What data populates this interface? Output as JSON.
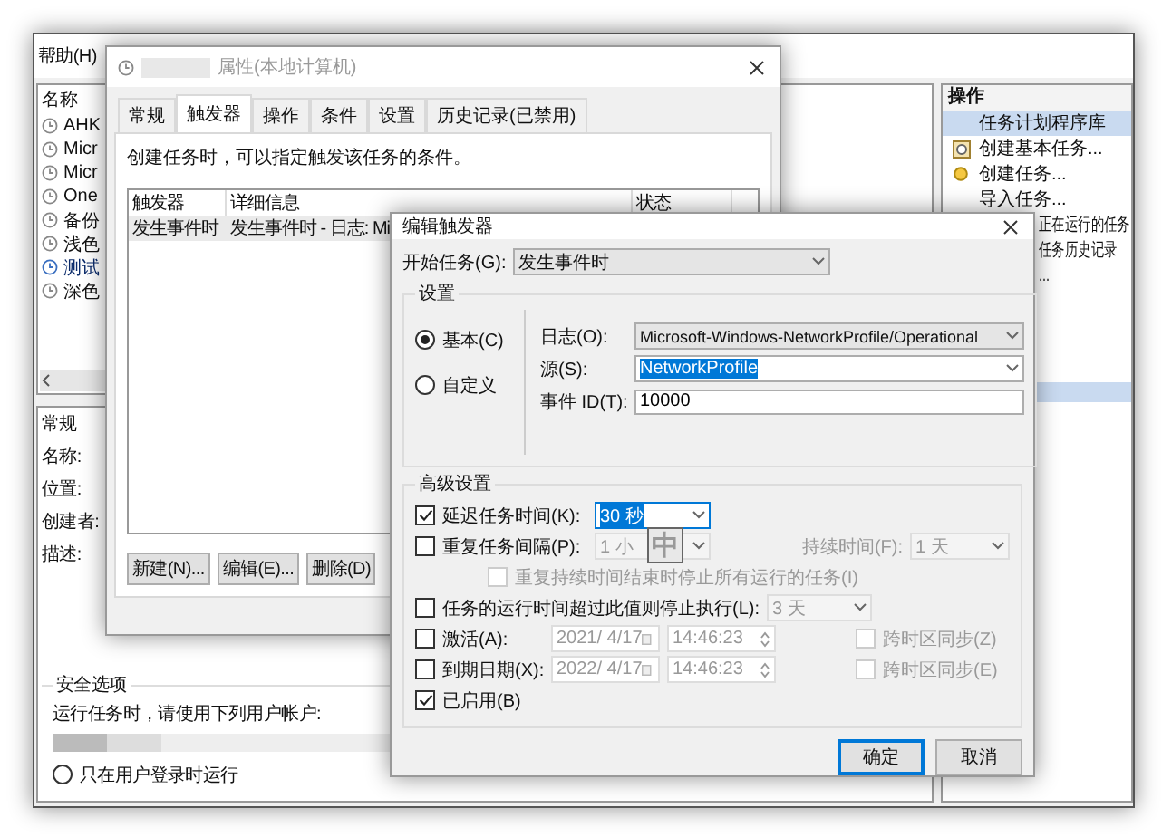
{
  "main_window": {
    "menu": [
      "帮助(H)"
    ],
    "task_list": {
      "header": "名称",
      "items": [
        {
          "name": "AHK",
          "selected": false
        },
        {
          "name": "Micr",
          "selected": false
        },
        {
          "name": "Micr",
          "selected": false
        },
        {
          "name": "One",
          "selected": false
        },
        {
          "name": "备份",
          "selected": false
        },
        {
          "name": "浅色",
          "selected": false
        },
        {
          "name": "测试",
          "selected": true
        },
        {
          "name": "深色",
          "selected": false
        }
      ]
    },
    "details": {
      "tab": "常规",
      "fields": [
        "名称:",
        "位置:",
        "创建者:",
        "描述:"
      ],
      "security": {
        "title": "安全选项",
        "prompt": "运行任务时，请使用下列用户帐户:",
        "radio": {
          "label": "只在用户登录时运行",
          "selected": false
        }
      }
    },
    "actions": {
      "title": "操作",
      "items": [
        {
          "label": "任务计划程序库",
          "kind": "plain",
          "selected": true
        },
        {
          "label": "创建基本任务...",
          "kind": "wizard",
          "selected": false
        },
        {
          "label": "创建任务...",
          "kind": "task",
          "selected": false
        },
        {
          "label": "导入任务...",
          "kind": "plain",
          "selected": false
        },
        {
          "label": "正在运行的任务",
          "kind": "clipped",
          "selected": false
        },
        {
          "label": "任务历史记录",
          "kind": "clipped",
          "selected": false
        },
        {
          "label": "...",
          "kind": "clipped",
          "selected": false
        }
      ]
    }
  },
  "properties_dialog": {
    "title": "属性(本地计算机)",
    "tabs": [
      {
        "label": "常规",
        "selected": false
      },
      {
        "label": "触发器",
        "selected": true
      },
      {
        "label": "操作",
        "selected": false
      },
      {
        "label": "条件",
        "selected": false
      },
      {
        "label": "设置",
        "selected": false
      },
      {
        "label": "历史记录(已禁用)",
        "selected": false
      }
    ],
    "description": "创建任务时，可以指定触发该任务的条件。",
    "table": {
      "columns": [
        "触发器",
        "详细信息",
        "状态"
      ],
      "rows": [
        {
          "trigger": "发生事件时",
          "details": "发生事件时 - 日志: Mi",
          "selected": true
        }
      ]
    },
    "buttons": [
      "新建(N)...",
      "编辑(E)...",
      "删除(D)"
    ]
  },
  "edit_trigger_dialog": {
    "title": "编辑触发器",
    "start": {
      "label": "开始任务(G):",
      "value": "发生事件时"
    },
    "settings": {
      "title": "设置",
      "modes": [
        {
          "label": "基本(C)",
          "selected": true
        },
        {
          "label": "自定义",
          "selected": false
        }
      ],
      "log": {
        "label": "日志(O):",
        "value": "Microsoft-Windows-NetworkProfile/Operational"
      },
      "source": {
        "label": "源(S):",
        "value": "NetworkProfile"
      },
      "event_id": {
        "label": "事件 ID(T):",
        "value": "10000"
      }
    },
    "advanced": {
      "title": "高级设置",
      "delay": {
        "label": "延迟任务时间(K):",
        "checked": true,
        "value": "30 秒"
      },
      "repeat": {
        "label": "重复任务间隔(P):",
        "checked": false,
        "value": "1 小",
        "duration_label": "持续时间(F):",
        "duration": "1 天"
      },
      "stop_repeat": {
        "label": "重复持续时间结束时停止所有运行的任务(I)",
        "checked": false
      },
      "stop_after": {
        "label": "任务的运行时间超过此值则停止执行(L):",
        "checked": false,
        "value": "3 天"
      },
      "activate": {
        "label": "激活(A):",
        "checked": false,
        "date": "2021/ 4/17",
        "time": "14:46:23",
        "sync_label": "跨时区同步(Z)",
        "sync_checked": false
      },
      "expire": {
        "label": "到期日期(X):",
        "checked": false,
        "date": "2022/ 4/17",
        "time": "14:46:23",
        "sync_label": "跨时区同步(E)",
        "sync_checked": false
      },
      "enabled": {
        "label": "已启用(B)",
        "checked": true
      }
    },
    "ime_indicator": "中",
    "buttons": [
      "确定",
      "取消"
    ]
  }
}
